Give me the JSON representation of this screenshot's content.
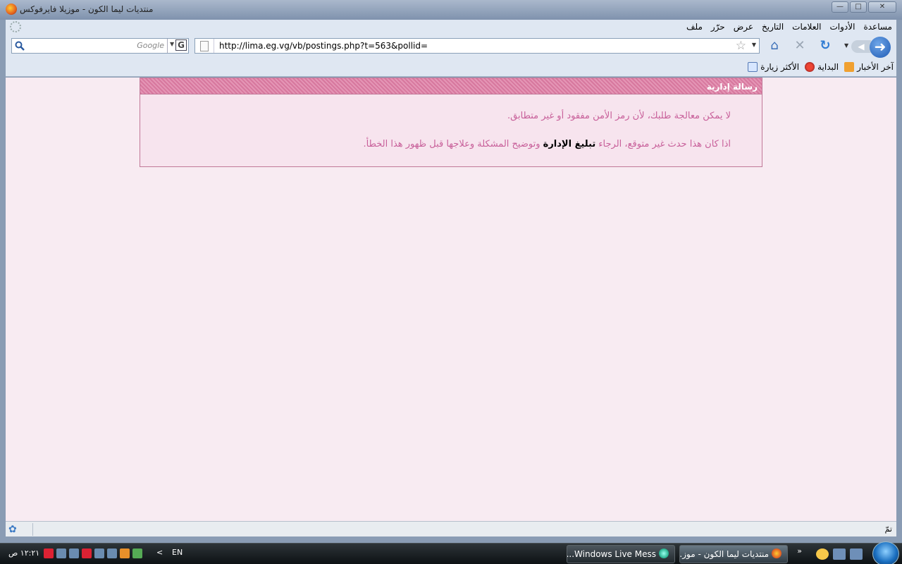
{
  "window": {
    "title": "منتديات ليما الكون - موزيلا فايرفوكس"
  },
  "menu": {
    "items": [
      "ملف",
      "حرّر",
      "عرض",
      "التاريخ",
      "العلامات",
      "الأدوات",
      "مساعدة"
    ]
  },
  "search": {
    "placeholder": "Google",
    "engine_letter": "G"
  },
  "address": {
    "url": "http://lima.eg.vg/vb/postings.php?t=563&pollid="
  },
  "bookmarks": {
    "items": [
      "الأكثر زيارة",
      "البداية",
      "آخر الأخبار"
    ]
  },
  "notice": {
    "title": "رسالة إدارية",
    "line1": "لا يمكن معالجة طلبك، لأن رمز الأمن مفقود أو غير متطابق.",
    "line2_before": "اذا كان هذا حدث غير متوقع، الرجاء",
    "line2_link": "تبليغ الإدارة",
    "line2_after": "وتوضيح المشكلة وعلاجها قبل ظهور هذا الخطأ."
  },
  "status": {
    "text": "تمّ"
  },
  "taskbar": {
    "firefox_task": "منتديات ليما الكون - موز...",
    "messenger_task": "Windows Live Mess...",
    "language": "EN",
    "clock": "١٢:٢١ ص",
    "quicklaunch_more": "»"
  },
  "colors": {
    "content_bg": "#f8ebf2",
    "notice_text": "#c8609a",
    "notice_header": "#d7789e"
  }
}
